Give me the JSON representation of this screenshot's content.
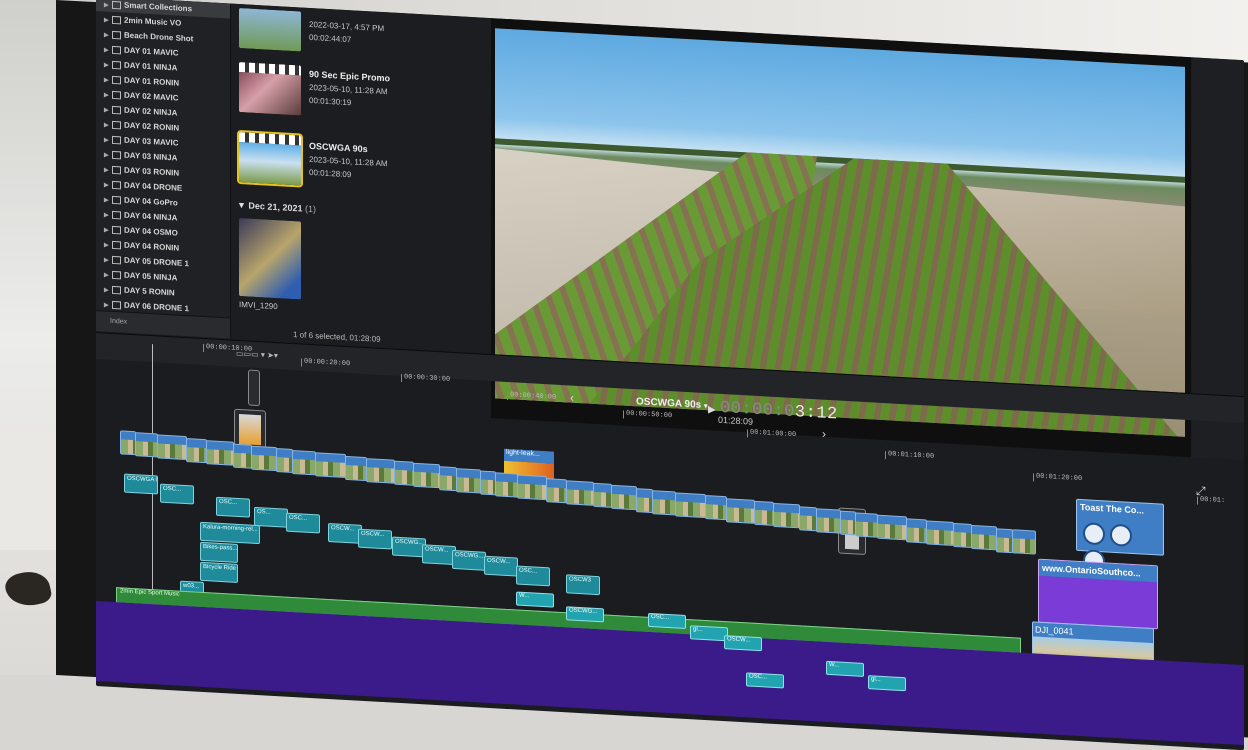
{
  "sidebar": {
    "items": [
      "Smart Collections",
      "2min Music VO",
      "Beach Drone Shot",
      "DAY 01 MAVIC",
      "DAY 01 NINJA",
      "DAY 01 RONIN",
      "DAY 02 MAVIC",
      "DAY 02 NINJA",
      "DAY 02 RONIN",
      "DAY 03 MAVIC",
      "DAY 03 NINJA",
      "DAY 03 RONIN",
      "DAY 04 DRONE",
      "DAY 04 GoPro",
      "DAY 04 NINJA",
      "DAY 04 OSMO",
      "DAY 04 RONIN",
      "DAY 05 DRONE 1",
      "DAY 05 NINJA",
      "DAY 5 RONIN",
      "DAY 06 DRONE 1"
    ],
    "tools_label": "Index"
  },
  "browser": {
    "top_clip": {
      "date": "2022-03-17, 4:57 PM",
      "duration": "00:02:44:07"
    },
    "clips": [
      {
        "title": "90 Sec Epic Promo",
        "date": "2023-05-10, 11:28 AM",
        "duration": "00:01:30:19"
      },
      {
        "title": "OSCWGA 90s",
        "date": "2023-05-10, 11:28 AM",
        "duration": "00:01:28:09"
      }
    ],
    "date_header": "Dec 21, 2021",
    "date_count": "(1)",
    "last_clip": {
      "title": "IMVI_1290"
    },
    "status": "1 of 6 selected, 01:28:09"
  },
  "viewer": {
    "timecode_dim": "00:00:0",
    "timecode_bright": "3:12"
  },
  "timeline": {
    "project_title": "OSCWGA 90s",
    "project_duration": "01:28:09",
    "ruler_ticks": [
      "00:00:10:00",
      "00:00:20:00",
      "00:00:30:00",
      "00:00:40:00",
      "00:00:50:00",
      "00:01:00:00",
      "00:01:10:00",
      "00:01:20:00",
      "00:01:"
    ],
    "primary_clip_labels": [
      "OSCWGA 0...",
      "OSC...",
      "OSC...",
      "OS...",
      "OSC...",
      "OSCW...",
      "OSCW...",
      "OSCWG...",
      "OSCW...",
      "OSCWG...",
      "OSCW...",
      "OSC...",
      "OSCW3"
    ],
    "connected_labels": [
      "Kalura-morning-rel...",
      "Bikes-pass...",
      "Bicycle Ride",
      "w03..."
    ],
    "audio_labels": [
      "W...",
      "OSCWG...",
      "OSC...",
      "gl...",
      "OSCW...",
      "W...",
      "gl...",
      "OSC..."
    ],
    "music_label": "2min Epic Sport Music",
    "light_leak_label": "light-leak...",
    "toast_title": "Toast The Co...",
    "web_title": "www.OntarioSouthco...",
    "dji_title": "DJI_0041"
  }
}
